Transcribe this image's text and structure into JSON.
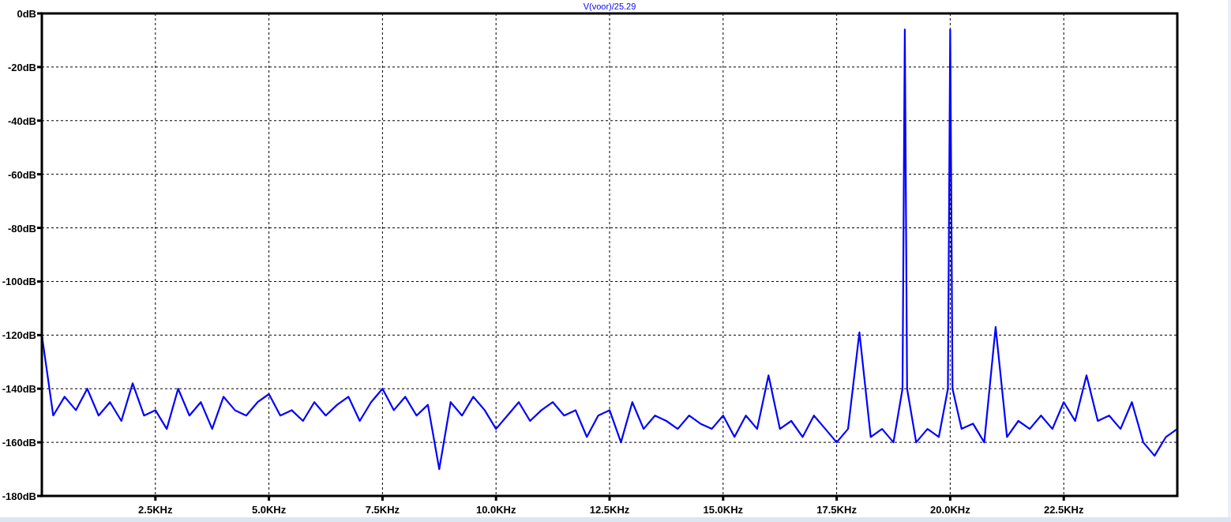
{
  "plot": {
    "chart_data": {
      "type": "line",
      "title": "V(voor)/25.29",
      "grid": true,
      "xlim": [
        0,
        25
      ],
      "ylim": [
        -180,
        0
      ],
      "xticks": [
        {
          "value": 2.5,
          "label": "2.5KHz"
        },
        {
          "value": 5,
          "label": "5.0KHz"
        },
        {
          "value": 7.5,
          "label": "7.5KHz"
        },
        {
          "value": 10,
          "label": "10.0KHz"
        },
        {
          "value": 12.5,
          "label": "12.5KHz"
        },
        {
          "value": 15,
          "label": "15.0KHz"
        },
        {
          "value": 17.5,
          "label": "17.5KHz"
        },
        {
          "value": 20,
          "label": "20.0KHz"
        },
        {
          "value": 22.5,
          "label": "22.5KHz"
        }
      ],
      "yticks": [
        {
          "value": 0,
          "label": "0dB"
        },
        {
          "value": -20,
          "label": "-20dB"
        },
        {
          "value": -40,
          "label": "-40dB"
        },
        {
          "value": -60,
          "label": "-60dB"
        },
        {
          "value": -80,
          "label": "-80dB"
        },
        {
          "value": -100,
          "label": "-100dB"
        },
        {
          "value": -120,
          "label": "-120dB"
        },
        {
          "value": -140,
          "label": "-140dB"
        },
        {
          "value": -160,
          "label": "-160dB"
        },
        {
          "value": -180,
          "label": "-180dB"
        }
      ],
      "x": [
        0,
        0.25,
        0.5,
        0.75,
        1,
        1.25,
        1.5,
        1.75,
        2,
        2.25,
        2.5,
        2.75,
        3,
        3.25,
        3.5,
        3.75,
        4,
        4.25,
        4.5,
        4.75,
        5,
        5.25,
        5.5,
        5.75,
        6,
        6.25,
        6.5,
        6.75,
        7,
        7.25,
        7.5,
        7.75,
        8,
        8.25,
        8.5,
        8.75,
        9,
        9.25,
        9.5,
        9.75,
        10,
        10.25,
        10.5,
        10.75,
        11,
        11.25,
        11.5,
        11.75,
        12,
        12.25,
        12.5,
        12.75,
        13,
        13.25,
        13.5,
        13.75,
        14,
        14.25,
        14.5,
        14.75,
        15,
        15.25,
        15.5,
        15.75,
        16,
        16.25,
        16.5,
        16.75,
        17,
        17.25,
        17.5,
        17.75,
        18,
        18.25,
        18.5,
        18.75,
        18.95,
        19,
        19.05,
        19.25,
        19.5,
        19.75,
        19.95,
        20,
        20.05,
        20.25,
        20.5,
        20.75,
        21,
        21.25,
        21.5,
        21.75,
        22,
        22.25,
        22.5,
        22.75,
        23,
        23.25,
        23.5,
        23.75,
        24,
        24.25,
        24.5,
        24.75,
        25
      ],
      "series": [
        {
          "color": "#0000ff",
          "values": [
            -120,
            -150,
            -143,
            -148,
            -140,
            -150,
            -145,
            -152,
            -138,
            -150,
            -148,
            -155,
            -140,
            -150,
            -145,
            -155,
            -143,
            -148,
            -150,
            -145,
            -142,
            -150,
            -148,
            -152,
            -145,
            -150,
            -146,
            -143,
            -152,
            -145,
            -140,
            -148,
            -143,
            -150,
            -146,
            -170,
            -145,
            -150,
            -143,
            -148,
            -155,
            -150,
            -145,
            -152,
            -148,
            -145,
            -150,
            -148,
            -158,
            -150,
            -148,
            -160,
            -145,
            -155,
            -150,
            -152,
            -155,
            -150,
            -153,
            -155,
            -150,
            -158,
            -150,
            -155,
            -135,
            -155,
            -152,
            -158,
            -150,
            -155,
            -160,
            -155,
            -119,
            -158,
            -155,
            -160,
            -140,
            -6,
            -140,
            -160,
            -155,
            -158,
            -140,
            -6,
            -140,
            -155,
            -153,
            -160,
            -117,
            -158,
            -152,
            -155,
            -150,
            -155,
            -145,
            -152,
            -135,
            -152,
            -150,
            -155,
            -145,
            -160,
            -165,
            -158,
            -155
          ]
        }
      ]
    }
  }
}
